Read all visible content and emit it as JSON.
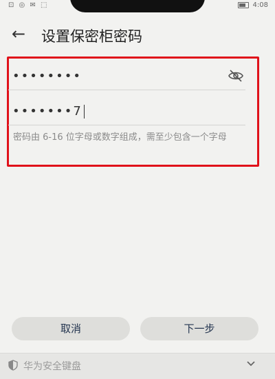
{
  "status_bar": {
    "left_icons": "⊡ ◎ ✉ ⬚",
    "time": "4:08"
  },
  "header": {
    "back_glyph": "←",
    "title": "设置保密柜密码"
  },
  "form": {
    "password": {
      "value": "••••••••"
    },
    "confirm": {
      "value": "•••••••7"
    },
    "hint": "密码由 6-16 位字母或数字组成，需至少包含一个字母"
  },
  "buttons": {
    "cancel": "取消",
    "next": "下一步"
  },
  "keyboard": {
    "label": "华为安全键盘"
  },
  "colors": {
    "highlight_border": "#e0111a",
    "button_text": "#23344f"
  }
}
